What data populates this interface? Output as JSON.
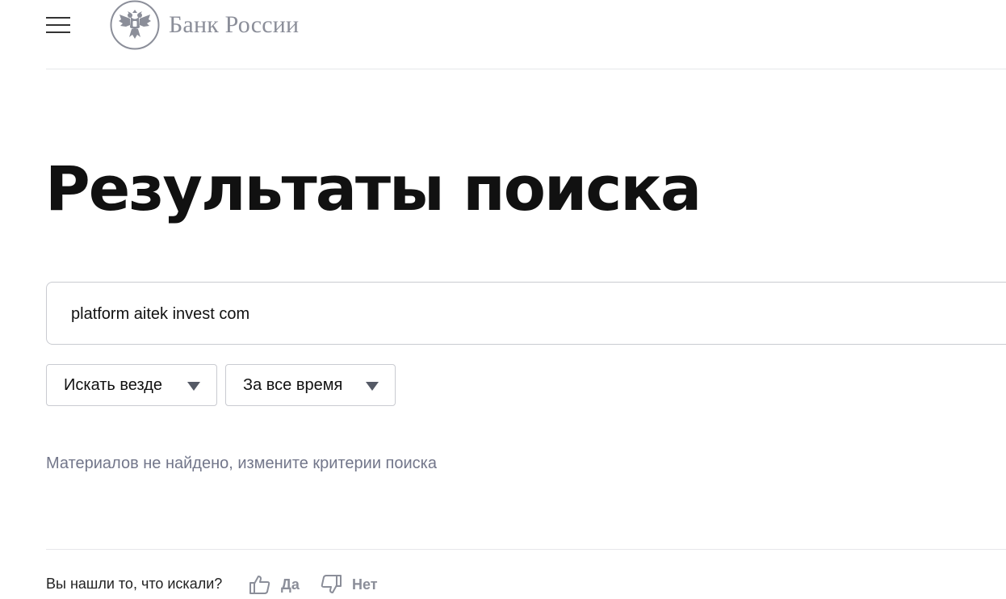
{
  "header": {
    "logo_text": "Банк России",
    "menu_icon": "hamburger-menu-icon",
    "emblem_icon": "double-headed-eagle-emblem"
  },
  "page": {
    "title": "Результаты поиска"
  },
  "search": {
    "value": "platform aitek invest com"
  },
  "filters": {
    "where": {
      "label": "Искать везде",
      "icon": "chevron-down-icon"
    },
    "when": {
      "label": "За все время",
      "icon": "chevron-down-icon"
    }
  },
  "results": {
    "empty_message": "Материалов не найдено, измените критерии поиска"
  },
  "feedback": {
    "question": "Вы нашли то, что искали?",
    "yes_label": "Да",
    "no_label": "Нет",
    "yes_icon": "thumbs-up-icon",
    "no_icon": "thumbs-down-icon"
  },
  "colors": {
    "text": "#111111",
    "muted": "#72768a",
    "logo_gray": "#8b8e99",
    "border": "#c9cbd1",
    "divider": "#e6e7ea"
  }
}
